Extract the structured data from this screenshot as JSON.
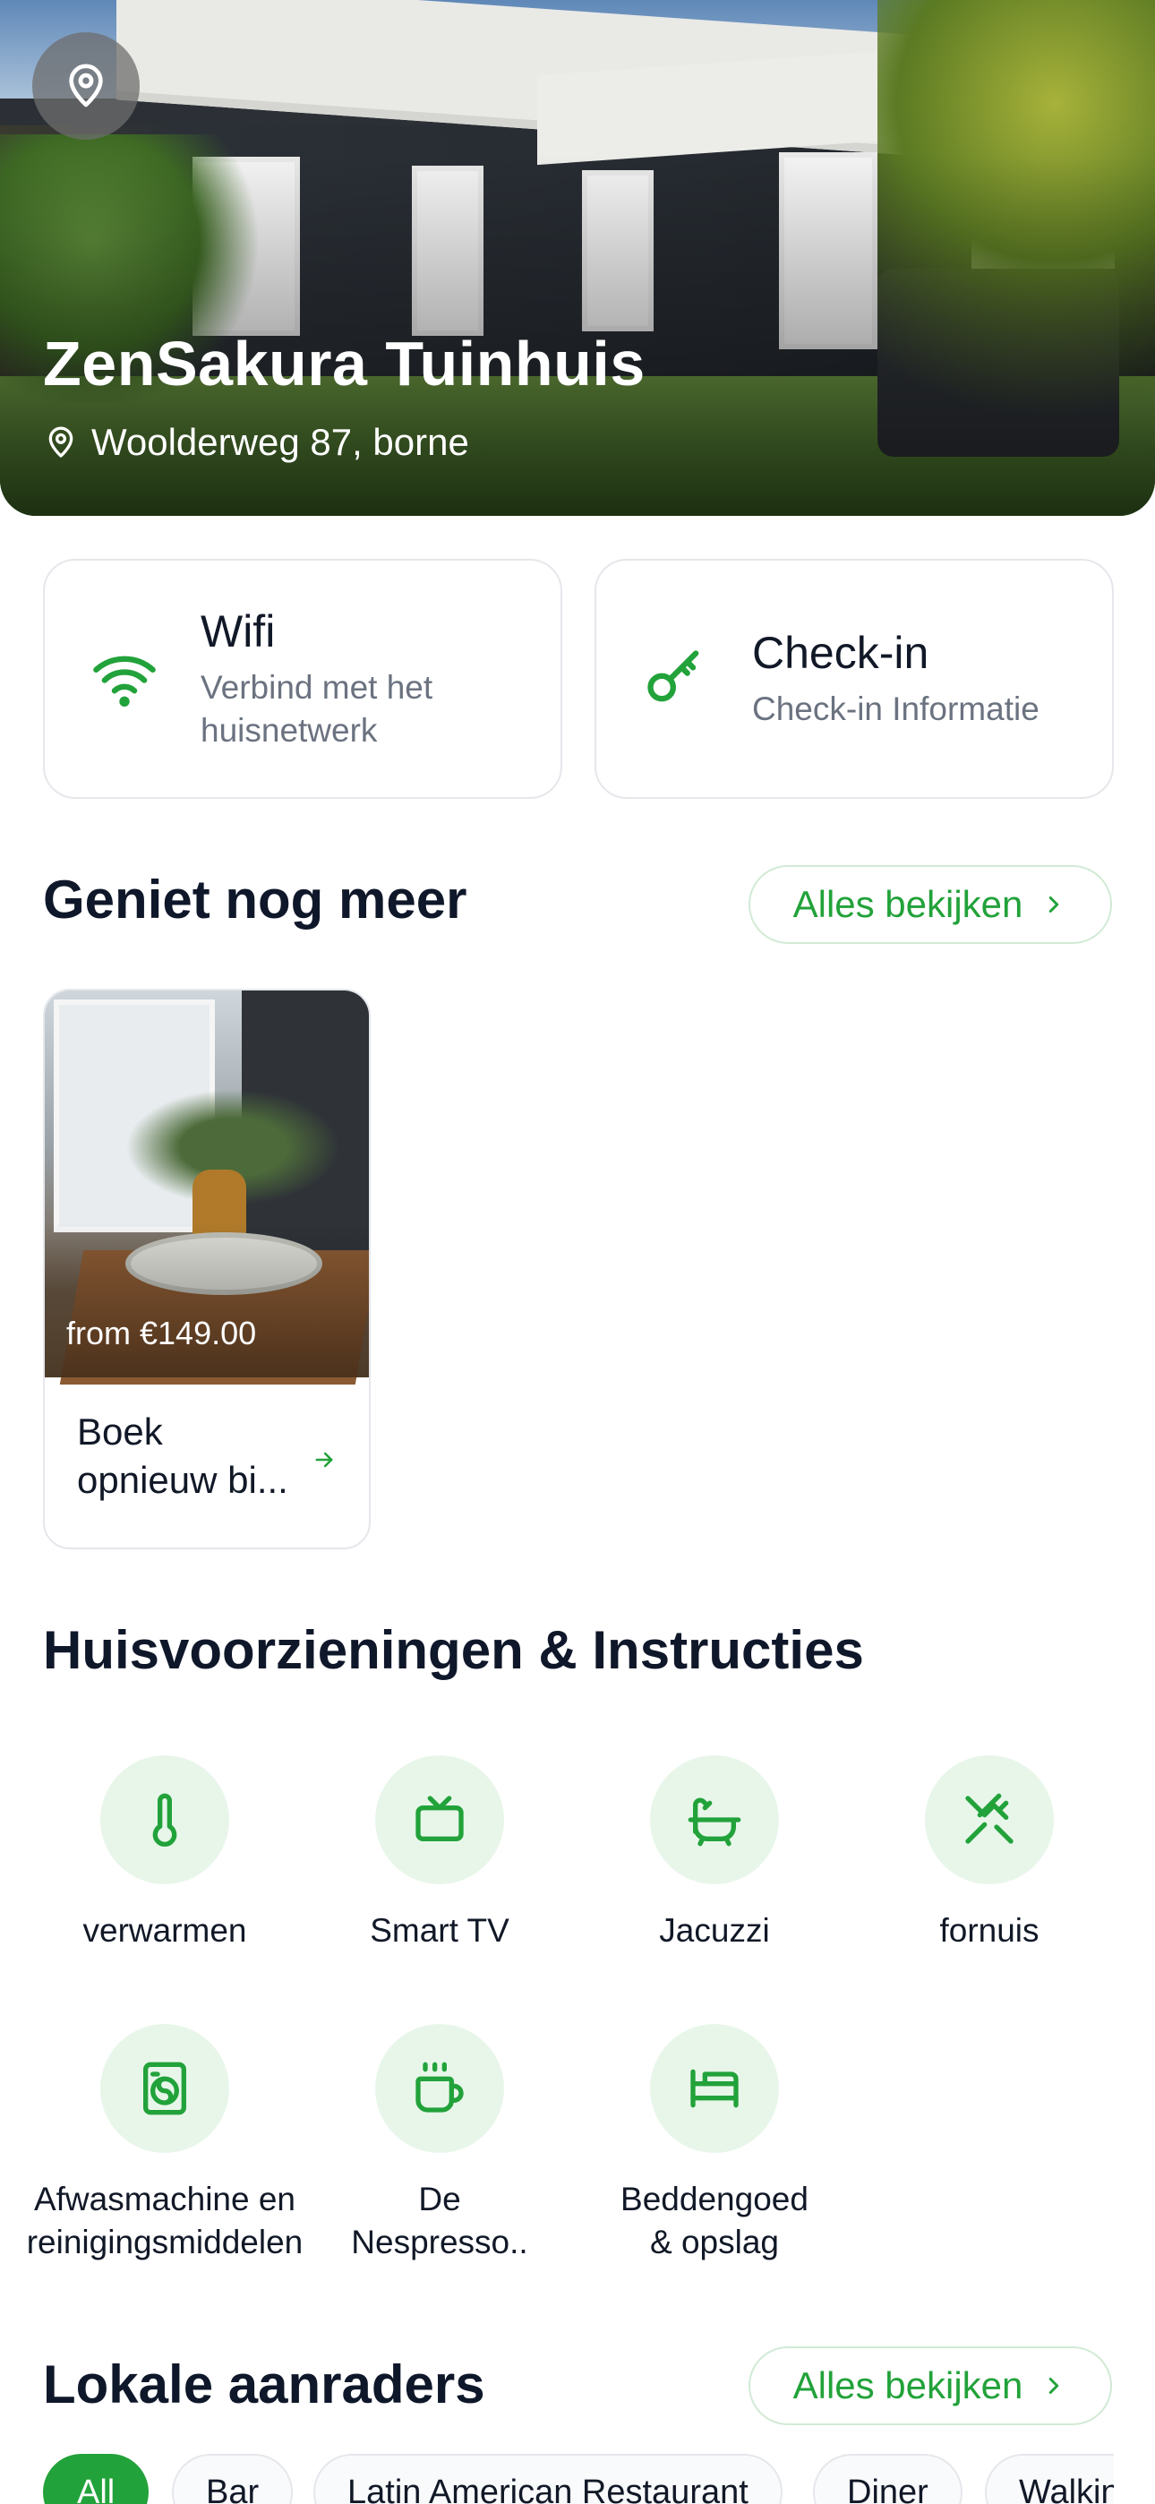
{
  "hero": {
    "title": "ZenSakura Tuinhuis",
    "address": "Woolderweg 87, borne"
  },
  "quick_cards": [
    {
      "title": "Wifi",
      "subtitle": "Verbind met het huisnetwerk",
      "icon": "wifi-icon"
    },
    {
      "title": "Check-in",
      "subtitle": "Check-in Informatie",
      "icon": "key-icon"
    }
  ],
  "enjoy": {
    "title": "Geniet nog meer",
    "view_all": "Alles bekijken",
    "offer": {
      "price": "from €149.00",
      "label": "Boek opnieuw bi..."
    }
  },
  "amenities": {
    "title": "Huisvoorzieningen & Instructies",
    "items": [
      {
        "label": "verwarmen",
        "icon": "thermometer-icon"
      },
      {
        "label": "Smart TV",
        "icon": "tv-icon"
      },
      {
        "label": "Jacuzzi",
        "icon": "bathtub-icon"
      },
      {
        "label": "fornuis",
        "icon": "utensils-icon"
      },
      {
        "label": "Afwasmachine en reinigingsmiddelen",
        "icon": "washing-machine-icon"
      },
      {
        "label": "De Nespresso..",
        "icon": "coffee-cup-icon"
      },
      {
        "label": "Beddengoed & opslag",
        "icon": "bed-icon"
      }
    ]
  },
  "local": {
    "title": "Lokale aanraders",
    "view_all": "Alles bekijken",
    "chips": [
      "All",
      "Bar",
      "Latin American Restaurant",
      "Diner",
      "Walkin"
    ]
  },
  "colors": {
    "accent": "#22a23a",
    "accent_light": "#e8f6ea"
  }
}
